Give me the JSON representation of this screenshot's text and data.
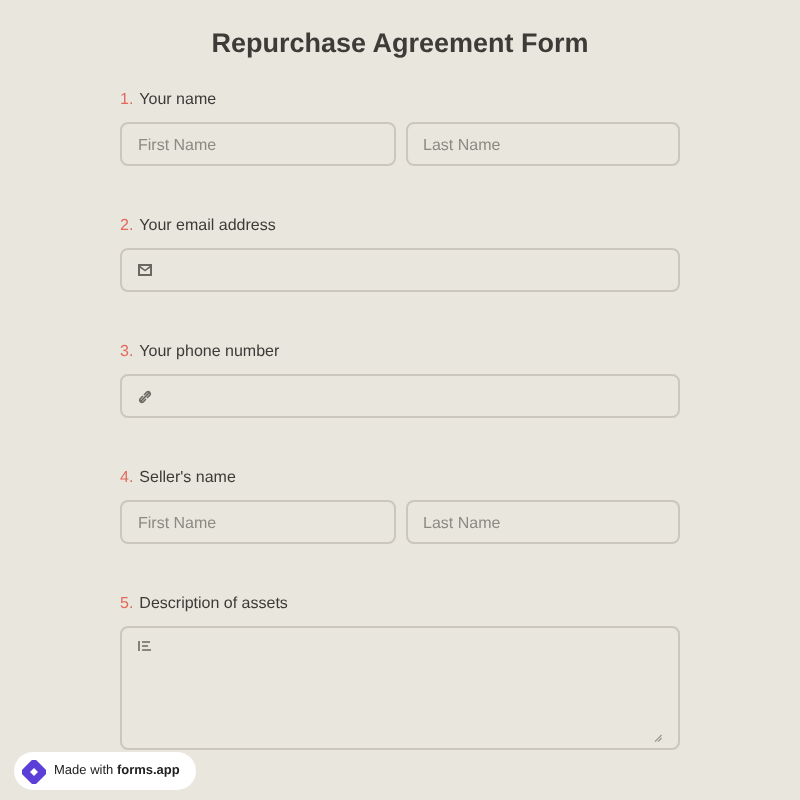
{
  "title": "Repurchase Agreement Form",
  "questions": [
    {
      "number": "1.",
      "label": "Your name",
      "kind": "name",
      "fields": [
        {
          "placeholder": "First Name"
        },
        {
          "placeholder": "Last Name"
        }
      ]
    },
    {
      "number": "2.",
      "label": "Your email address",
      "kind": "email"
    },
    {
      "number": "3.",
      "label": "Your phone number",
      "kind": "phone"
    },
    {
      "number": "4.",
      "label": "Seller's name",
      "kind": "name",
      "fields": [
        {
          "placeholder": "First Name"
        },
        {
          "placeholder": "Last Name"
        }
      ]
    },
    {
      "number": "5.",
      "label": "Description of assets",
      "kind": "textarea"
    }
  ],
  "badge": {
    "text": "Made with **forms.app**"
  }
}
